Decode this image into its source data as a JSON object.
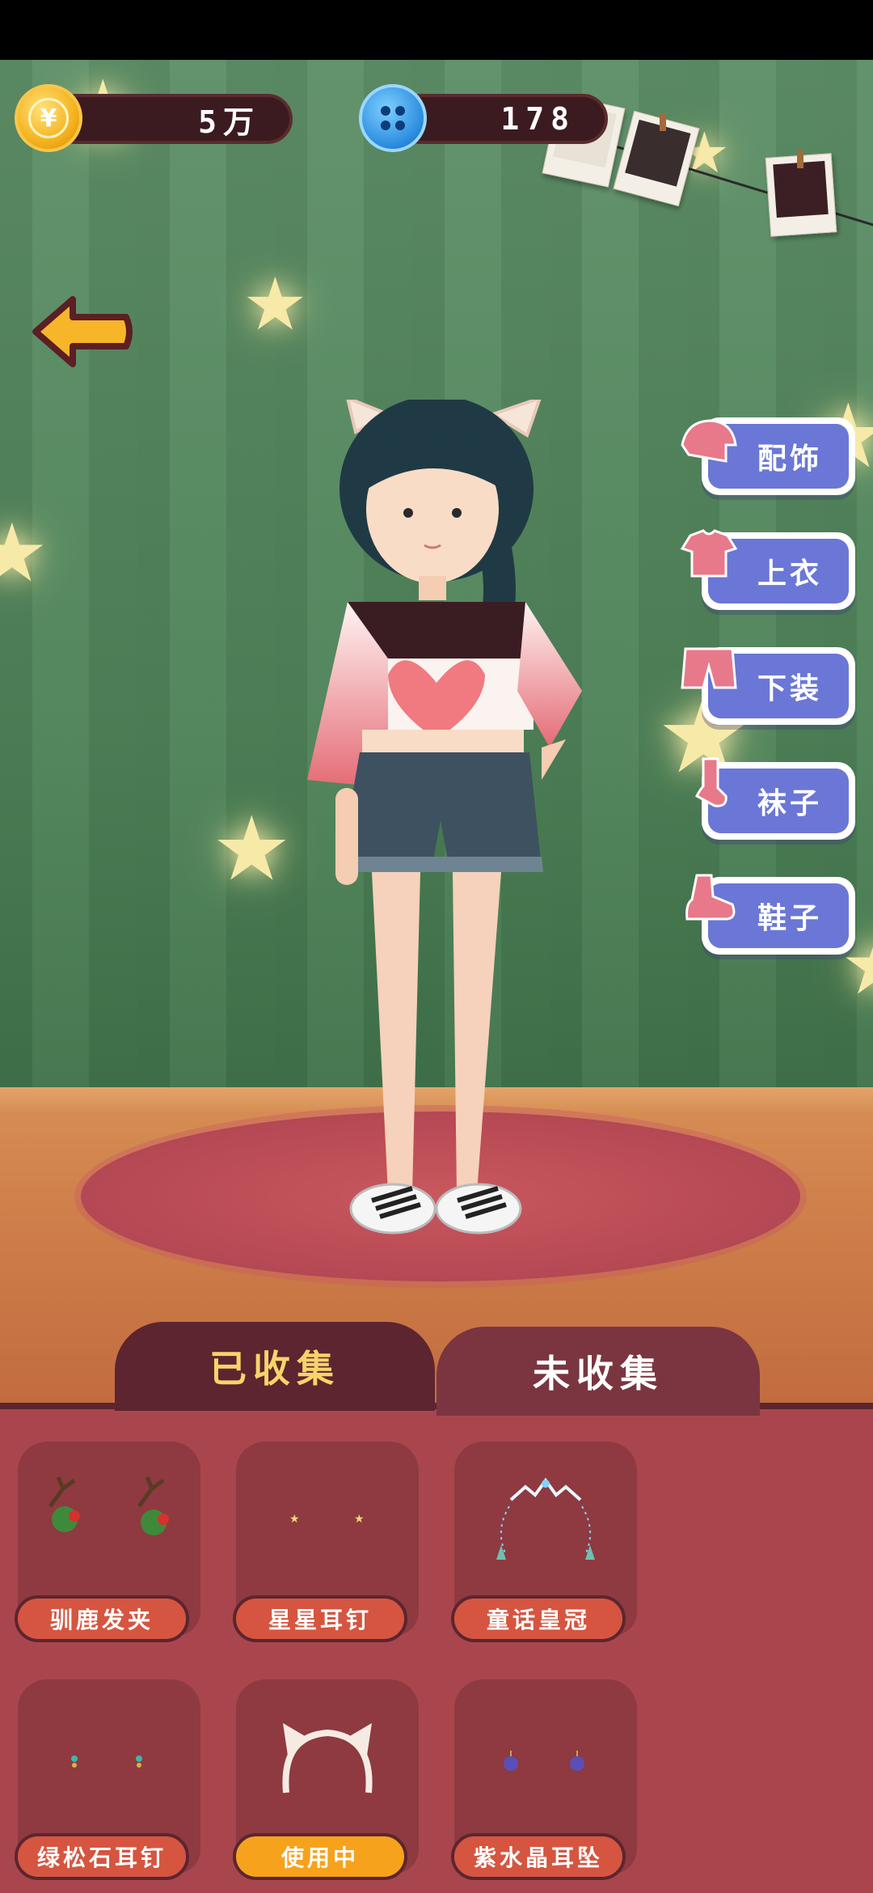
{
  "currency": {
    "coins": "5万",
    "buttons": "178"
  },
  "categories": [
    {
      "label": "配饰",
      "icon": "hat-icon"
    },
    {
      "label": "上衣",
      "icon": "shirt-icon"
    },
    {
      "label": "下装",
      "icon": "shorts-icon"
    },
    {
      "label": "袜子",
      "icon": "sock-icon"
    },
    {
      "label": "鞋子",
      "icon": "shoe-icon"
    }
  ],
  "tabs": {
    "collected": "已收集",
    "uncollected": "未收集"
  },
  "items": [
    {
      "label": "驯鹿发夹",
      "icon": "reindeer-hairclip-icon",
      "in_use": false
    },
    {
      "label": "星星耳钉",
      "icon": "star-earring-icon",
      "in_use": false
    },
    {
      "label": "童话皇冠",
      "icon": "fairy-crown-icon",
      "in_use": false
    },
    {
      "label": "绿松石耳钉",
      "icon": "turquoise-earring-icon",
      "in_use": false
    },
    {
      "label": "使用中",
      "icon": "cat-ear-headband-icon",
      "in_use": true
    },
    {
      "label": "紫水晶耳坠",
      "icon": "amethyst-earring-icon",
      "in_use": false
    }
  ],
  "colors": {
    "panel": "#a9464d",
    "tab_active_text": "#f7d46a",
    "button_blue": "#6a77d6",
    "label_red": "#d55540",
    "label_in_use": "#f7a21d"
  }
}
